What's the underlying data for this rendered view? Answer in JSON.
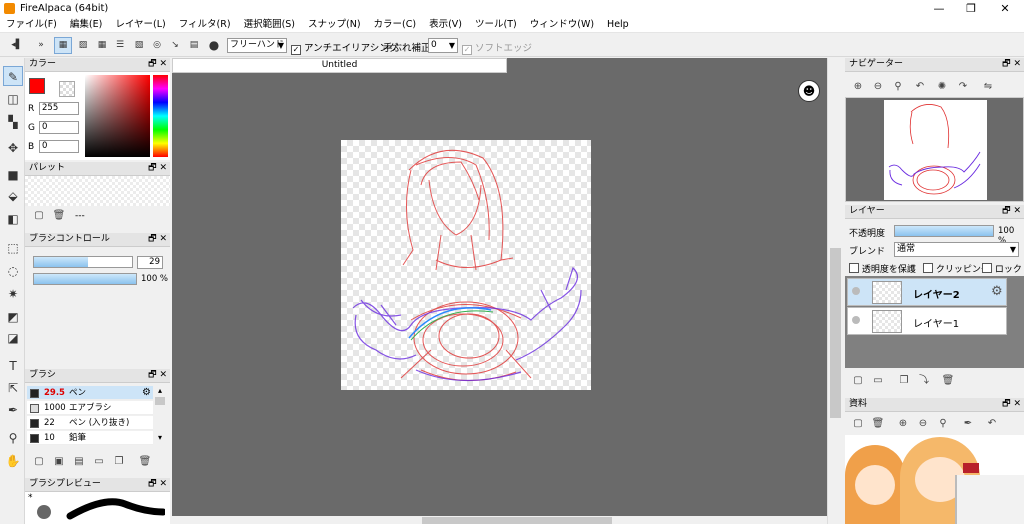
{
  "window": {
    "title": "FireAlpaca (64bit)"
  },
  "menu": [
    "ファイル(F)",
    "編集(E)",
    "レイヤー(L)",
    "フィルタ(R)",
    "選択範囲(S)",
    "スナップ(N)",
    "カラー(C)",
    "表示(V)",
    "ツール(T)",
    "ウィンドウ(W)",
    "Help"
  ],
  "toolbar": {
    "mode": "フリーハンド",
    "antialias": "アンチエイリアシング",
    "stabilizer_label": "手ぶれ補正",
    "stabilizer_value": "0",
    "softedge": "ソフトエッジ"
  },
  "color_panel": {
    "title": "カラー",
    "r_label": "R",
    "r": "255",
    "g_label": "G",
    "g": "0",
    "b_label": "B",
    "b": "0",
    "fg_color": "#ff0000"
  },
  "palette_panel": {
    "title": "パレット",
    "empty_mark": "---"
  },
  "brush_control": {
    "title": "ブラシコントロール",
    "size": "29",
    "size_fraction": 0.55,
    "opacity": "100 %",
    "opacity_fraction": 1.0
  },
  "brush_panel": {
    "title": "ブラシ",
    "items": [
      {
        "size": "29.5",
        "name": "ペン",
        "color": "#222222"
      },
      {
        "size": "1000",
        "name": "エアブラシ",
        "color": "#dddddd"
      },
      {
        "size": "22",
        "name": "ペン (入り抜き)",
        "color": "#222222"
      },
      {
        "size": "10",
        "name": "鉛筆",
        "color": "#222222"
      }
    ]
  },
  "brush_preview": {
    "title": "ブラシプレビュー",
    "marker": "*"
  },
  "document": {
    "tab": "Untitled"
  },
  "navigator": {
    "title": "ナビゲーター"
  },
  "layer_panel": {
    "title": "レイヤー",
    "opacity_label": "不透明度",
    "opacity_value": "100 %",
    "opacity_fraction": 1.0,
    "blend_label": "ブレンド",
    "blend_value": "通常",
    "protect_label": "透明度を保護",
    "clipping_label": "クリッピング",
    "lock_label": "ロック",
    "layers": [
      {
        "name": "レイヤー2"
      },
      {
        "name": "レイヤー1"
      }
    ]
  },
  "material_panel": {
    "title": "資料"
  }
}
